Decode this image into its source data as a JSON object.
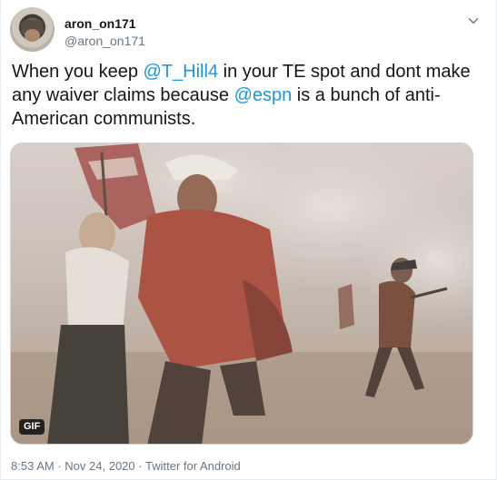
{
  "tweet": {
    "display_name": "aron_on171",
    "handle": "@aron_on171",
    "text_parts": [
      {
        "type": "text",
        "value": "When you keep "
      },
      {
        "type": "mention",
        "value": "@T_Hill4"
      },
      {
        "type": "text",
        "value": " in your TE spot and dont make any waiver claims because "
      },
      {
        "type": "mention",
        "value": "@espn"
      },
      {
        "type": "text",
        "value": " is a bunch of anti-American communists."
      }
    ],
    "media_badge": "GIF",
    "time": "8:53 AM",
    "date": "Nov 24, 2020",
    "source": "Twitter for Android",
    "separator": "·"
  },
  "icons": {
    "caret": "chevron-down-icon"
  },
  "colors": {
    "link": "#1b95e0",
    "muted": "#657786",
    "text": "#14171a",
    "border": "#e6ecf0"
  }
}
